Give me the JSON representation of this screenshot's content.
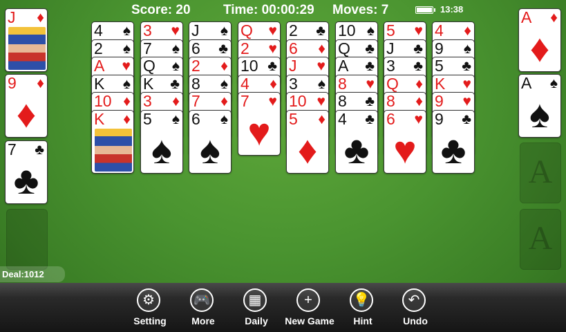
{
  "status": {
    "score_text": "Score: 20",
    "time_text": "Time: 00:00:29",
    "moves_text": "Moves: 7",
    "clock": "13:38"
  },
  "deal_text": "Deal:1012",
  "suit_colors": {
    "red": "#e31b1b",
    "black": "#111111"
  },
  "freecells": [
    {
      "rank": "J",
      "suit": "♦",
      "color": "red",
      "face": true
    },
    {
      "rank": "9",
      "suit": "♦",
      "color": "red"
    },
    {
      "rank": "7",
      "suit": "♣",
      "color": "black"
    },
    null
  ],
  "foundations": [
    {
      "rank": "A",
      "suit": "♦",
      "color": "red"
    },
    {
      "rank": "A",
      "suit": "♠",
      "color": "black"
    },
    {
      "placeholder": "A"
    },
    {
      "placeholder": "A"
    }
  ],
  "tableau": [
    [
      {
        "rank": "4",
        "suit": "♠",
        "color": "black"
      },
      {
        "rank": "2",
        "suit": "♠",
        "color": "black"
      },
      {
        "rank": "A",
        "suit": "♥",
        "color": "red"
      },
      {
        "rank": "K",
        "suit": "♠",
        "color": "black"
      },
      {
        "rank": "10",
        "suit": "♦",
        "color": "red"
      },
      {
        "rank": "K",
        "suit": "♦",
        "color": "red",
        "face": true
      }
    ],
    [
      {
        "rank": "3",
        "suit": "♥",
        "color": "red"
      },
      {
        "rank": "7",
        "suit": "♠",
        "color": "black"
      },
      {
        "rank": "Q",
        "suit": "♠",
        "color": "black"
      },
      {
        "rank": "K",
        "suit": "♣",
        "color": "black"
      },
      {
        "rank": "3",
        "suit": "♦",
        "color": "red"
      },
      {
        "rank": "5",
        "suit": "♠",
        "color": "black"
      }
    ],
    [
      {
        "rank": "J",
        "suit": "♠",
        "color": "black"
      },
      {
        "rank": "6",
        "suit": "♣",
        "color": "black"
      },
      {
        "rank": "2",
        "suit": "♦",
        "color": "red"
      },
      {
        "rank": "8",
        "suit": "♠",
        "color": "black"
      },
      {
        "rank": "7",
        "suit": "♦",
        "color": "red"
      },
      {
        "rank": "6",
        "suit": "♠",
        "color": "black"
      }
    ],
    [
      {
        "rank": "Q",
        "suit": "♥",
        "color": "red"
      },
      {
        "rank": "2",
        "suit": "♥",
        "color": "red"
      },
      {
        "rank": "10",
        "suit": "♣",
        "color": "black"
      },
      {
        "rank": "4",
        "suit": "♦",
        "color": "red"
      },
      {
        "rank": "7",
        "suit": "♥",
        "color": "red"
      }
    ],
    [
      {
        "rank": "2",
        "suit": "♣",
        "color": "black"
      },
      {
        "rank": "6",
        "suit": "♦",
        "color": "red"
      },
      {
        "rank": "J",
        "suit": "♥",
        "color": "red"
      },
      {
        "rank": "3",
        "suit": "♠",
        "color": "black"
      },
      {
        "rank": "10",
        "suit": "♥",
        "color": "red"
      },
      {
        "rank": "5",
        "suit": "♦",
        "color": "red"
      }
    ],
    [
      {
        "rank": "10",
        "suit": "♠",
        "color": "black"
      },
      {
        "rank": "Q",
        "suit": "♣",
        "color": "black"
      },
      {
        "rank": "A",
        "suit": "♣",
        "color": "black"
      },
      {
        "rank": "8",
        "suit": "♥",
        "color": "red"
      },
      {
        "rank": "8",
        "suit": "♣",
        "color": "black"
      },
      {
        "rank": "4",
        "suit": "♣",
        "color": "black"
      }
    ],
    [
      {
        "rank": "5",
        "suit": "♥",
        "color": "red"
      },
      {
        "rank": "J",
        "suit": "♣",
        "color": "black"
      },
      {
        "rank": "3",
        "suit": "♣",
        "color": "black"
      },
      {
        "rank": "Q",
        "suit": "♦",
        "color": "red"
      },
      {
        "rank": "8",
        "suit": "♦",
        "color": "red"
      },
      {
        "rank": "6",
        "suit": "♥",
        "color": "red"
      }
    ],
    [
      {
        "rank": "4",
        "suit": "♦",
        "color": "red"
      },
      {
        "rank": "9",
        "suit": "♠",
        "color": "black"
      },
      {
        "rank": "5",
        "suit": "♣",
        "color": "black"
      },
      {
        "rank": "K",
        "suit": "♥",
        "color": "red"
      },
      {
        "rank": "9",
        "suit": "♥",
        "color": "red"
      },
      {
        "rank": "9",
        "suit": "♣",
        "color": "black"
      }
    ]
  ],
  "toolbar": [
    {
      "label": "Setting",
      "icon": "gear-icon",
      "glyph": "⚙"
    },
    {
      "label": "More",
      "icon": "gamepad-icon",
      "glyph": "🎮"
    },
    {
      "label": "Daily",
      "icon": "calendar-icon",
      "glyph": "▦"
    },
    {
      "label": "New Game",
      "icon": "plus-icon",
      "glyph": "+"
    },
    {
      "label": "Hint",
      "icon": "lightbulb-icon",
      "glyph": "💡"
    },
    {
      "label": "Undo",
      "icon": "undo-icon",
      "glyph": "↶"
    }
  ]
}
